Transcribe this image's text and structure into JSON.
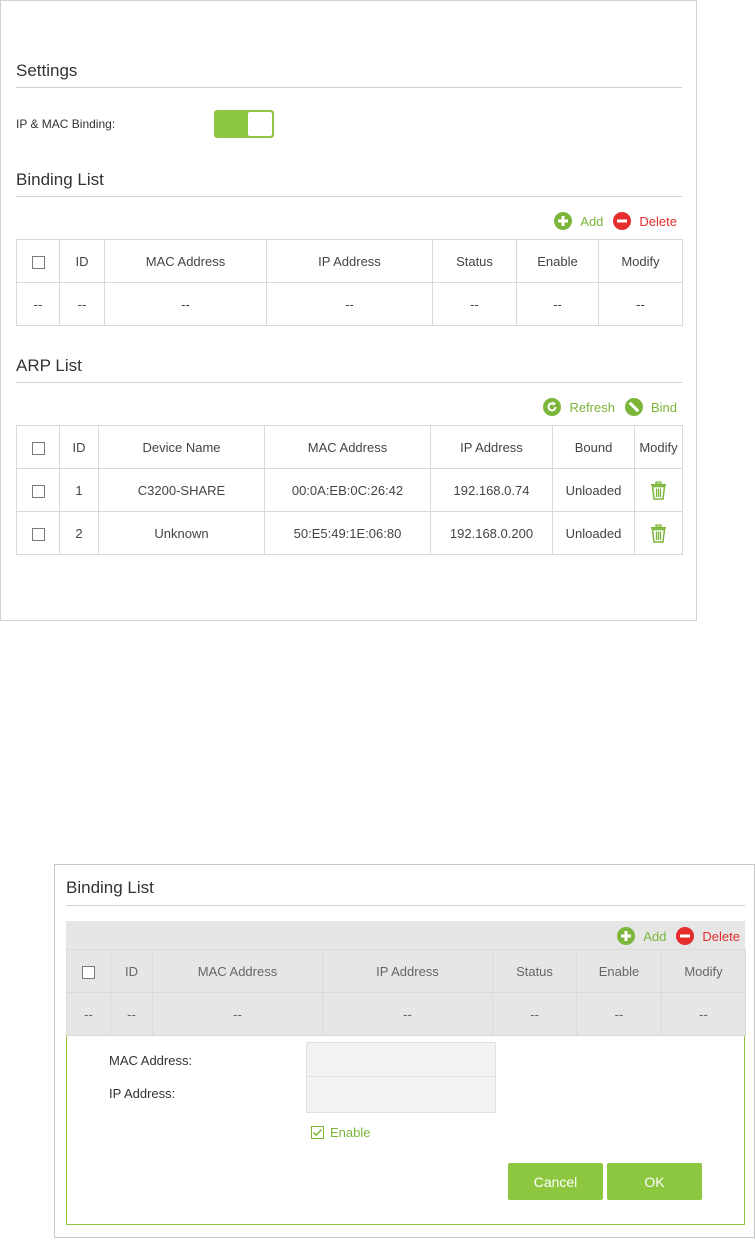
{
  "settings": {
    "title": "Settings",
    "ip_mac_binding_label": "IP & MAC Binding:",
    "ip_mac_binding_on": true
  },
  "binding_list": {
    "title": "Binding List",
    "add_label": "Add",
    "delete_label": "Delete",
    "columns": [
      "ID",
      "MAC Address",
      "IP Address",
      "Status",
      "Enable",
      "Modify"
    ],
    "empty_row": [
      "--",
      "--",
      "--",
      "--",
      "--",
      "--",
      "--"
    ]
  },
  "arp_list": {
    "title": "ARP List",
    "refresh_label": "Refresh",
    "bind_label": "Bind",
    "columns": [
      "ID",
      "Device Name",
      "MAC Address",
      "IP Address",
      "Bound",
      "Modify"
    ],
    "rows": [
      {
        "id": "1",
        "device": "C3200-SHARE",
        "mac": "00:0A:EB:0C:26:42",
        "ip": "192.168.0.74",
        "bound": "Unloaded"
      },
      {
        "id": "2",
        "device": "Unknown",
        "mac": "50:E5:49:1E:06:80",
        "ip": "192.168.0.200",
        "bound": "Unloaded"
      }
    ]
  },
  "binding_dialog": {
    "title": "Binding List",
    "add_label": "Add",
    "delete_label": "Delete",
    "columns": [
      "ID",
      "MAC Address",
      "IP Address",
      "Status",
      "Enable",
      "Modify"
    ],
    "empty_row": [
      "--",
      "--",
      "--",
      "--",
      "--",
      "--",
      "--"
    ],
    "mac_label": "MAC Address:",
    "ip_label": "IP Address:",
    "mac_value": "",
    "ip_value": "",
    "enable_label": "Enable",
    "enable_checked": true,
    "cancel_label": "Cancel",
    "ok_label": "OK"
  },
  "colors": {
    "accent_green": "#8dc63f",
    "action_green": "#7bb63a",
    "delete_red": "#e52d2d"
  }
}
